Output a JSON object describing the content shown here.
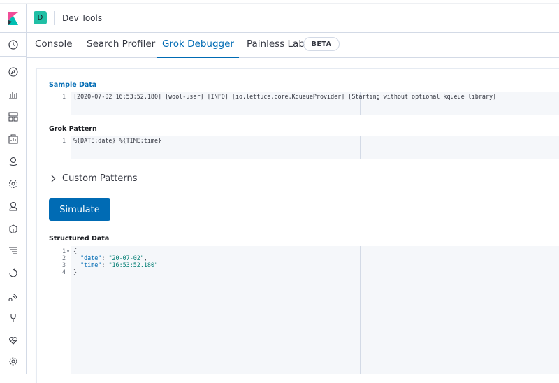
{
  "header": {
    "space_initial": "D",
    "breadcrumb": "Dev Tools"
  },
  "tabs": [
    {
      "label": "Console"
    },
    {
      "label": "Search Profiler"
    },
    {
      "label": "Grok Debugger"
    },
    {
      "label": "Painless Lab"
    }
  ],
  "active_tab": "Grok Debugger",
  "beta_badge": "BETA",
  "sample_data": {
    "label": "Sample Data",
    "lines": [
      {
        "num": "1",
        "text": "[2020-07-02 16:53:52.180] [wool-user] [INFO] [io.lettuce.core.KqueueProvider] [Starting without optional kqueue library]"
      }
    ]
  },
  "grok_pattern": {
    "label": "Grok Pattern",
    "lines": [
      {
        "num": "1",
        "text": "%{DATE:date} %{TIME:time}"
      }
    ]
  },
  "custom_patterns": {
    "label": "Custom Patterns"
  },
  "simulate_button": "Simulate",
  "structured_data": {
    "label": "Structured Data",
    "line_numbers": [
      "1",
      "2",
      "3",
      "4"
    ],
    "fold_marker": "▾",
    "open_brace": "{",
    "close_brace": "}",
    "date_key": "\"date\"",
    "date_value": "\"20-07-02\"",
    "time_key": "\"time\"",
    "time_value": "\"16:53:52.180\"",
    "colon": ": ",
    "comma": ","
  },
  "colors": {
    "accent": "#006bb4",
    "space_avatar": "#20bfa5",
    "editor_bg": "#f5f7fa"
  }
}
